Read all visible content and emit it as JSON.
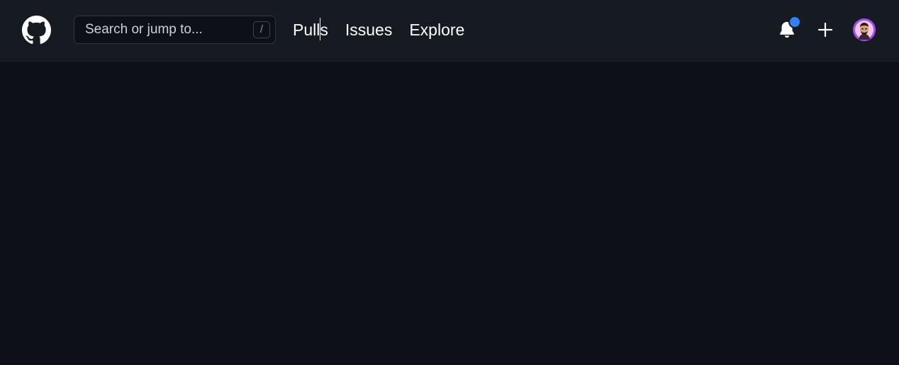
{
  "header": {
    "logo_icon": "github-octocat-icon",
    "search": {
      "placeholder": "Search or jump to...",
      "value": "",
      "shortcut_key": "/"
    },
    "nav": {
      "items": [
        {
          "label": "Pulls"
        },
        {
          "label": "Issues"
        },
        {
          "label": "Explore"
        }
      ]
    },
    "notifications_icon": "bell-icon",
    "has_unread_notifications": true,
    "create_icon": "plus-icon",
    "avatar_icon": "user-avatar"
  },
  "colors": {
    "header_bg": "#161b22",
    "page_bg": "#0d1117",
    "notification_dot": "#2f81f7",
    "avatar_bg": "#a34cf0"
  }
}
